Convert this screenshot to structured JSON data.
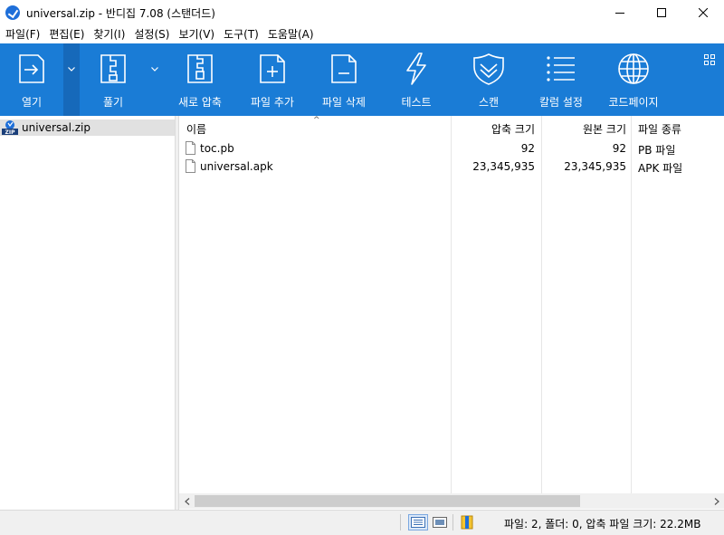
{
  "window": {
    "title": "universal.zip - 반디집 7.08 (스탠더드)"
  },
  "menu": [
    "파일(F)",
    "편집(E)",
    "찾기(I)",
    "설정(S)",
    "보기(V)",
    "도구(T)",
    "도움말(A)"
  ],
  "toolbar": {
    "background": "#1a7cd6",
    "items": [
      {
        "label": "열기",
        "icon": "open-archive-icon"
      },
      {
        "label": "풀기",
        "icon": "extract-icon"
      },
      {
        "label": "새로 압축",
        "icon": "new-archive-icon"
      },
      {
        "label": "파일 추가",
        "icon": "add-file-icon"
      },
      {
        "label": "파일 삭제",
        "icon": "delete-file-icon"
      },
      {
        "label": "테스트",
        "icon": "test-lightning-icon"
      },
      {
        "label": "스캔",
        "icon": "scan-shield-icon"
      },
      {
        "label": "칼럼 설정",
        "icon": "column-settings-icon"
      },
      {
        "label": "코드페이지",
        "icon": "codepage-globe-icon"
      }
    ]
  },
  "tree": {
    "root": "universal.zip"
  },
  "filelist": {
    "columns": {
      "name": "이름",
      "compressed": "압축 크기",
      "original": "원본 크기",
      "type": "파일 종류"
    },
    "rows": [
      {
        "name": "toc.pb",
        "compressed": "92",
        "original": "92",
        "type": "PB 파일"
      },
      {
        "name": "universal.apk",
        "compressed": "23,345,935",
        "original": "23,345,935",
        "type": "APK 파일"
      }
    ]
  },
  "status": {
    "text": "파일: 2, 폴더: 0, 압축 파일 크기: 22.2MB"
  }
}
